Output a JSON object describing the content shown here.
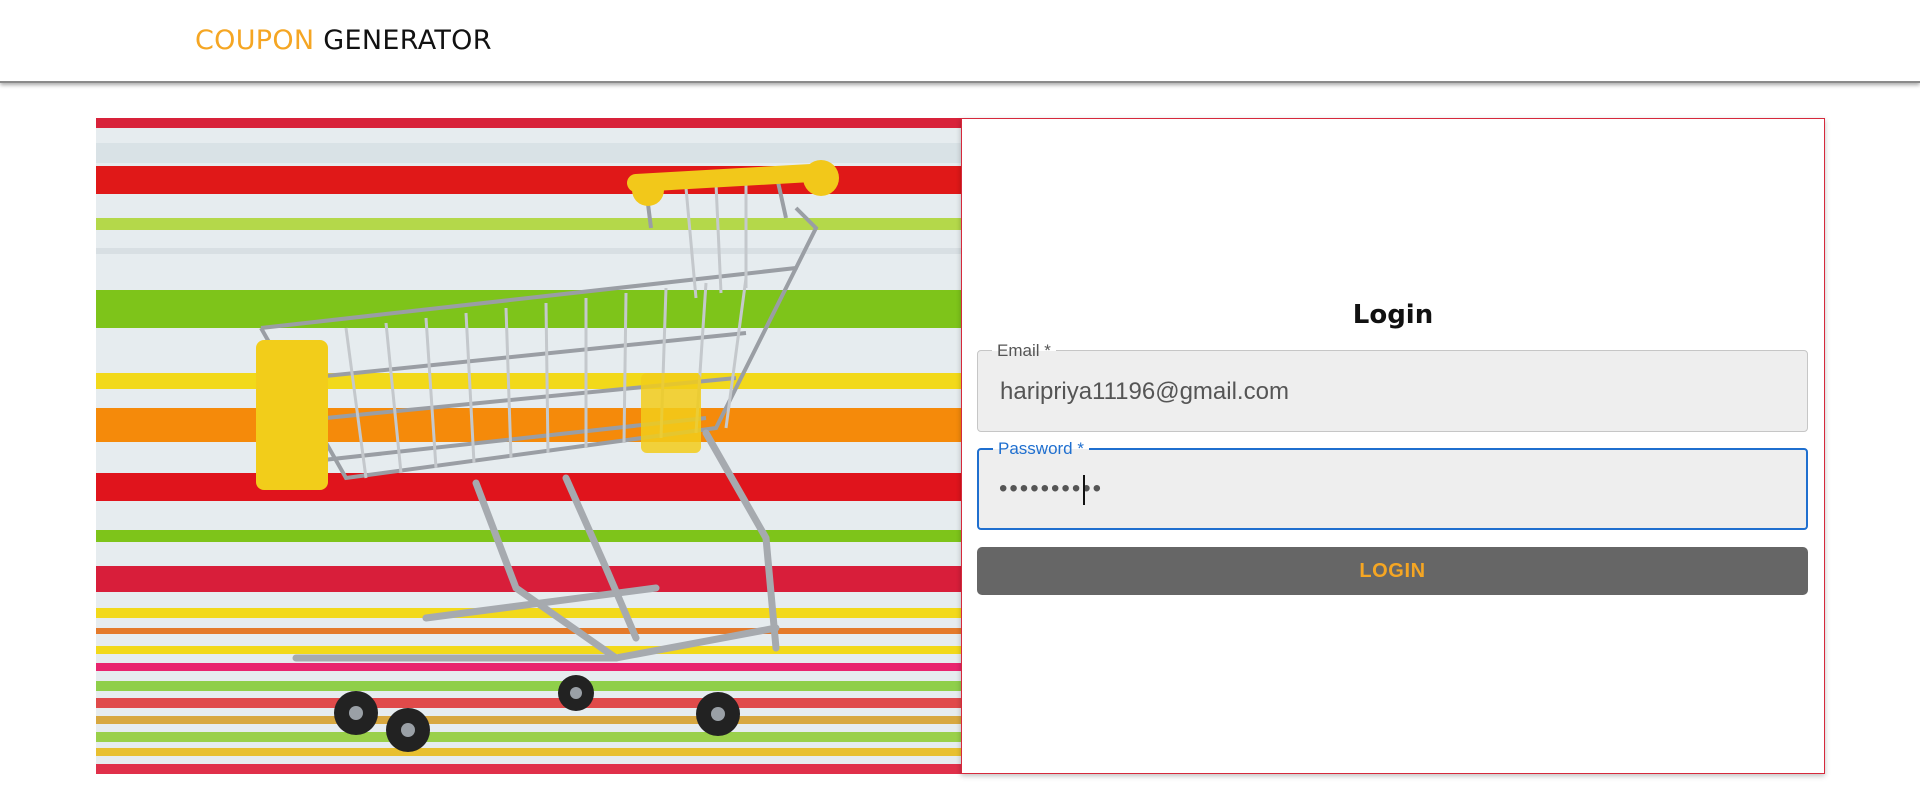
{
  "header": {
    "brand_part1": "COUPON",
    "brand_part2": "GENERATOR",
    "colors": {
      "accent": "#f5a623",
      "text": "#111111"
    }
  },
  "hero": {
    "image": "shopping-cart-on-striped-background"
  },
  "login": {
    "title": "Login",
    "email_label": "Email *",
    "email_value": "haripriya11196@gmail.com",
    "password_label": "Password *",
    "password_value": "••••••••••",
    "button_label": "LOGIN",
    "colors": {
      "focus": "#1f6fcf",
      "button_bg": "#666666",
      "button_text": "#f5a623",
      "card_border": "#d6293c"
    }
  }
}
